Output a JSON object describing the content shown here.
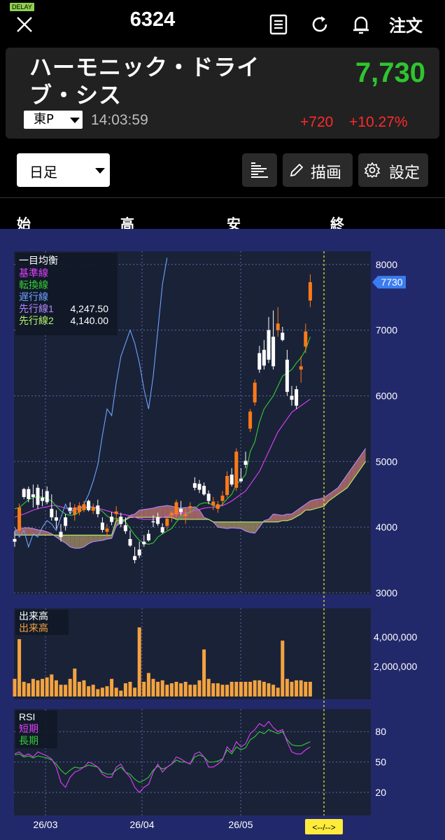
{
  "header": {
    "delay_badge": "DELAY",
    "code": "6324",
    "order_label": "注文",
    "icons": [
      "close-icon",
      "report-icon",
      "refresh-icon",
      "bell-icon"
    ]
  },
  "quote": {
    "name": "ハーモニック・ドライブ・シス",
    "price": "7,730",
    "market": "東P",
    "time": "14:03:59",
    "change": "+720",
    "change_pct": "+10.27%",
    "up_color": "#2fc52f",
    "down_color": "#ff2a2a"
  },
  "controls": {
    "period": "日足",
    "draw_label": "描画",
    "settings_label": "設定"
  },
  "ohlc_labels": {
    "open": "始",
    "high": "高",
    "low": "安",
    "close": "終"
  },
  "colors": {
    "chart_bg": "#1a2238",
    "frame_bg": "#22296b",
    "candle_up": "#ff7a17",
    "candle_down": "#ffffff"
  },
  "chart_data": {
    "type": "candlestick",
    "price_axis": {
      "ticks": [
        3000,
        4000,
        5000,
        6000,
        7000,
        8000
      ],
      "ylim": [
        3000,
        8200
      ]
    },
    "last_price_tag": "7730",
    "x_ticks": [
      "26/03",
      "26/04",
      "26/05"
    ],
    "ichimoku_legend": {
      "title": "一目均衡",
      "lines": [
        {
          "name": "基準線",
          "value": "",
          "color": "#e040fb"
        },
        {
          "name": "転換線",
          "value": "",
          "color": "#33cc33"
        },
        {
          "name": "遅行線",
          "value": "",
          "color": "#6fa1ff"
        },
        {
          "name": "先行線1",
          "value": "4,247.50",
          "color": "#b388ff"
        },
        {
          "name": "先行線2",
          "value": "4,140.00",
          "color": "#b5f26b"
        }
      ]
    },
    "candles": [
      [
        3820,
        3940,
        3700,
        3780
      ],
      [
        3950,
        4360,
        3900,
        4300
      ],
      [
        4580,
        4600,
        4430,
        4460
      ],
      [
        4580,
        4620,
        4380,
        4430
      ],
      [
        4500,
        4650,
        4300,
        4460
      ],
      [
        4600,
        4650,
        4280,
        4340
      ],
      [
        4450,
        4580,
        4320,
        4400
      ],
      [
        4550,
        4620,
        4350,
        4380
      ],
      [
        4280,
        4500,
        4100,
        4150
      ],
      [
        4150,
        4260,
        3980,
        4100
      ],
      [
        3930,
        4050,
        3780,
        3850
      ],
      [
        4150,
        4200,
        3950,
        4020
      ],
      [
        4300,
        4380,
        4200,
        4250
      ],
      [
        4190,
        4350,
        4100,
        4300
      ],
      [
        4230,
        4380,
        4180,
        4330
      ],
      [
        4260,
        4400,
        4230,
        4350
      ],
      [
        4400,
        4420,
        4240,
        4260
      ],
      [
        4250,
        4360,
        4200,
        4300
      ],
      [
        4330,
        4420,
        4150,
        4200
      ],
      [
        4070,
        4150,
        3920,
        3960
      ],
      [
        3930,
        4050,
        3850,
        3980
      ],
      [
        4160,
        4230,
        4030,
        4080
      ],
      [
        4200,
        4320,
        4100,
        4240
      ],
      [
        4160,
        4220,
        4000,
        4050
      ],
      [
        4030,
        4150,
        3900,
        3940
      ],
      [
        3820,
        3950,
        3700,
        3720
      ],
      [
        3560,
        3700,
        3450,
        3500
      ],
      [
        3660,
        3780,
        3530,
        3570
      ],
      [
        3780,
        3880,
        3700,
        3740
      ],
      [
        3900,
        3960,
        3780,
        3800
      ],
      [
        4090,
        4180,
        4000,
        4080
      ],
      [
        4150,
        4220,
        4020,
        4050
      ],
      [
        4000,
        4060,
        3900,
        3920
      ],
      [
        4020,
        4160,
        3960,
        4130
      ],
      [
        4180,
        4250,
        4080,
        4220
      ],
      [
        4200,
        4420,
        4150,
        4380
      ],
      [
        4280,
        4400,
        4180,
        4230
      ],
      [
        4170,
        4280,
        4050,
        4200
      ],
      [
        4300,
        4380,
        4200,
        4320
      ],
      [
        4670,
        4760,
        4560,
        4600
      ],
      [
        4660,
        4720,
        4520,
        4570
      ],
      [
        4630,
        4680,
        4480,
        4500
      ],
      [
        4510,
        4560,
        4350,
        4400
      ],
      [
        4330,
        4460,
        4260,
        4390
      ],
      [
        4280,
        4400,
        4220,
        4350
      ],
      [
        4400,
        4550,
        4320,
        4480
      ],
      [
        4490,
        4850,
        4450,
        4780
      ],
      [
        4800,
        4900,
        4620,
        4650
      ],
      [
        4600,
        5200,
        4550,
        5150
      ],
      [
        4740,
        4900,
        4680,
        4700
      ],
      [
        5010,
        5150,
        4900,
        4950
      ],
      [
        5500,
        5800,
        5450,
        5760
      ],
      [
        5900,
        6250,
        5850,
        6200
      ],
      [
        6650,
        6760,
        6350,
        6400
      ],
      [
        6700,
        6850,
        6400,
        6460
      ],
      [
        7000,
        7200,
        6500,
        6550
      ],
      [
        6900,
        7300,
        6400,
        6450
      ],
      [
        7000,
        7350,
        6900,
        7100
      ],
      [
        6960,
        7050,
        6830,
        6850
      ],
      [
        6550,
        6700,
        6000,
        6060
      ],
      [
        6000,
        6150,
        5850,
        5940
      ],
      [
        6100,
        6150,
        5800,
        5850
      ],
      [
        6400,
        6600,
        6200,
        6450
      ],
      [
        6750,
        7100,
        6650,
        6980
      ],
      [
        7450,
        7850,
        7350,
        7730
      ]
    ],
    "tenkan": [
      4280,
      4300,
      4360,
      4420,
      4450,
      4460,
      4460,
      4430,
      4400,
      4320,
      4250,
      4200,
      4180,
      4190,
      4230,
      4280,
      4310,
      4300,
      4280,
      4240,
      4170,
      4130,
      4130,
      4140,
      4080,
      3980,
      3880,
      3800,
      3760,
      3740,
      3760,
      3850,
      3900,
      3940,
      3980,
      4080,
      4150,
      4200,
      4230,
      4280,
      4350,
      4370,
      4370,
      4330,
      4310,
      4350,
      4430,
      4500,
      4650,
      4720,
      4800,
      5150,
      5300,
      5600,
      5800,
      5900,
      6000,
      6150,
      6300,
      6350,
      6400,
      6500,
      6580,
      6700,
      6900
    ],
    "kijun": [
      4150,
      4180,
      4200,
      4230,
      4260,
      4280,
      4300,
      4310,
      4330,
      4330,
      4310,
      4290,
      4280,
      4290,
      4300,
      4310,
      4310,
      4310,
      4290,
      4270,
      4250,
      4230,
      4210,
      4200,
      4190,
      4170,
      4150,
      4130,
      4120,
      4120,
      4120,
      4130,
      4150,
      4170,
      4190,
      4200,
      4210,
      4220,
      4230,
      4250,
      4270,
      4290,
      4300,
      4300,
      4310,
      4330,
      4360,
      4400,
      4450,
      4500,
      4550,
      4650,
      4750,
      4850,
      5000,
      5150,
      5300,
      5450,
      5550,
      5650,
      5750,
      5800,
      5850,
      5900,
      5950
    ],
    "chikou": [
      4000,
      3850,
      3950,
      3700,
      3900,
      3850,
      4000,
      4100,
      4050,
      3950,
      4150,
      4350,
      4200,
      4300,
      4250,
      4350,
      4500,
      4700,
      4950,
      5400,
      5800,
      5700,
      6200,
      6600,
      6800,
      7000,
      6800,
      6500,
      6100,
      5800,
      6300,
      7000,
      7700,
      8100
    ],
    "senkou1": [
      3950,
      3970,
      3990,
      3990,
      3980,
      3960,
      3950,
      3930,
      3900,
      3850,
      3800,
      3760,
      3700,
      3680,
      3680,
      3700,
      3750,
      3780,
      3790,
      3800,
      3820,
      3830,
      4020,
      4060,
      4120,
      4180,
      4200,
      4260,
      4270,
      4280,
      4290,
      4310,
      4320,
      4330,
      4320,
      4300,
      4290,
      4300,
      4300,
      4310,
      4260,
      4150,
      4120,
      4080,
      4000,
      3990,
      3980,
      3990,
      3985,
      3980,
      3940,
      3920,
      3910,
      4000,
      4100,
      4120,
      4200,
      4190,
      4180,
      4200,
      4200,
      4250,
      4300,
      4350,
      4400,
      4420,
      4430,
      4450,
      4500,
      4550,
      4600,
      4700,
      4800,
      4900,
      5000,
      5100,
      5200
    ],
    "senkou2": [
      3880,
      3880,
      3880,
      3880,
      3880,
      3880,
      3880,
      3880,
      3880,
      3880,
      3880,
      3880,
      3880,
      3880,
      3880,
      3880,
      3880,
      3880,
      3880,
      3880,
      3880,
      3880,
      4110,
      4110,
      4110,
      4150,
      4150,
      4150,
      4150,
      4150,
      4150,
      4150,
      4150,
      4150,
      4150,
      4120,
      4120,
      4120,
      4120,
      4120,
      4120,
      4120,
      4120,
      4080,
      4080,
      4080,
      4080,
      4080,
      4080,
      4080,
      4080,
      4080,
      4080,
      4080,
      4080,
      4080,
      4080,
      4080,
      4100,
      4100,
      4120,
      4160,
      4200,
      4260,
      4260,
      4280,
      4300,
      4320,
      4400,
      4450,
      4500,
      4550,
      4600,
      4700,
      4800,
      4900,
      5000
    ],
    "volume": {
      "title": "出来高",
      "series_label": "出来高",
      "ticks": [
        "4,000,000",
        "2,000,000"
      ],
      "values": [
        1.2,
        3.9,
        1.0,
        0.9,
        1.2,
        1.1,
        1.2,
        1.3,
        1.5,
        1.1,
        0.8,
        0.8,
        1.2,
        1.9,
        1.0,
        1.1,
        0.7,
        0.8,
        0.5,
        0.6,
        0.7,
        1.2,
        0.6,
        0.4,
        0.9,
        1.0,
        0.6,
        4.7,
        1.0,
        1.6,
        1.2,
        1.0,
        1.1,
        0.8,
        0.9,
        1.0,
        0.9,
        1.0,
        0.8,
        0.8,
        1.1,
        3.2,
        1.2,
        0.9,
        0.9,
        0.8,
        0.8,
        1.0,
        1.0,
        1.0,
        1.0,
        1.0,
        1.1,
        1.1,
        1.0,
        0.9,
        0.8,
        0.6,
        3.8,
        1.2,
        1.0,
        1.1,
        1.1,
        1.0,
        1.0
      ]
    },
    "rsi": {
      "title": "RSI",
      "short_label": "短期",
      "long_label": "長期",
      "ticks": [
        "80",
        "50",
        "20"
      ],
      "short": [
        58,
        60,
        56,
        58,
        55,
        60,
        58,
        56,
        53,
        45,
        30,
        25,
        35,
        40,
        42,
        45,
        50,
        48,
        45,
        38,
        35,
        35,
        45,
        48,
        40,
        35,
        25,
        20,
        25,
        28,
        40,
        48,
        40,
        45,
        48,
        55,
        53,
        50,
        48,
        58,
        60,
        55,
        45,
        45,
        48,
        52,
        65,
        60,
        70,
        65,
        68,
        78,
        82,
        88,
        85,
        90,
        84,
        80,
        82,
        70,
        60,
        58,
        58,
        62,
        65
      ],
      "long": [
        57,
        58,
        55,
        56,
        54,
        56,
        55,
        54,
        52,
        48,
        42,
        38,
        42,
        45,
        44,
        45,
        47,
        46,
        45,
        40,
        38,
        38,
        42,
        45,
        40,
        38,
        33,
        30,
        32,
        35,
        42,
        46,
        43,
        45,
        48,
        52,
        50,
        50,
        48,
        55,
        57,
        55,
        50,
        50,
        51,
        53,
        62,
        58,
        65,
        62,
        64,
        72,
        75,
        80,
        78,
        82,
        80,
        78,
        80,
        72,
        67,
        66,
        66,
        68,
        70
      ]
    },
    "cursor_label": "<--/-->"
  }
}
